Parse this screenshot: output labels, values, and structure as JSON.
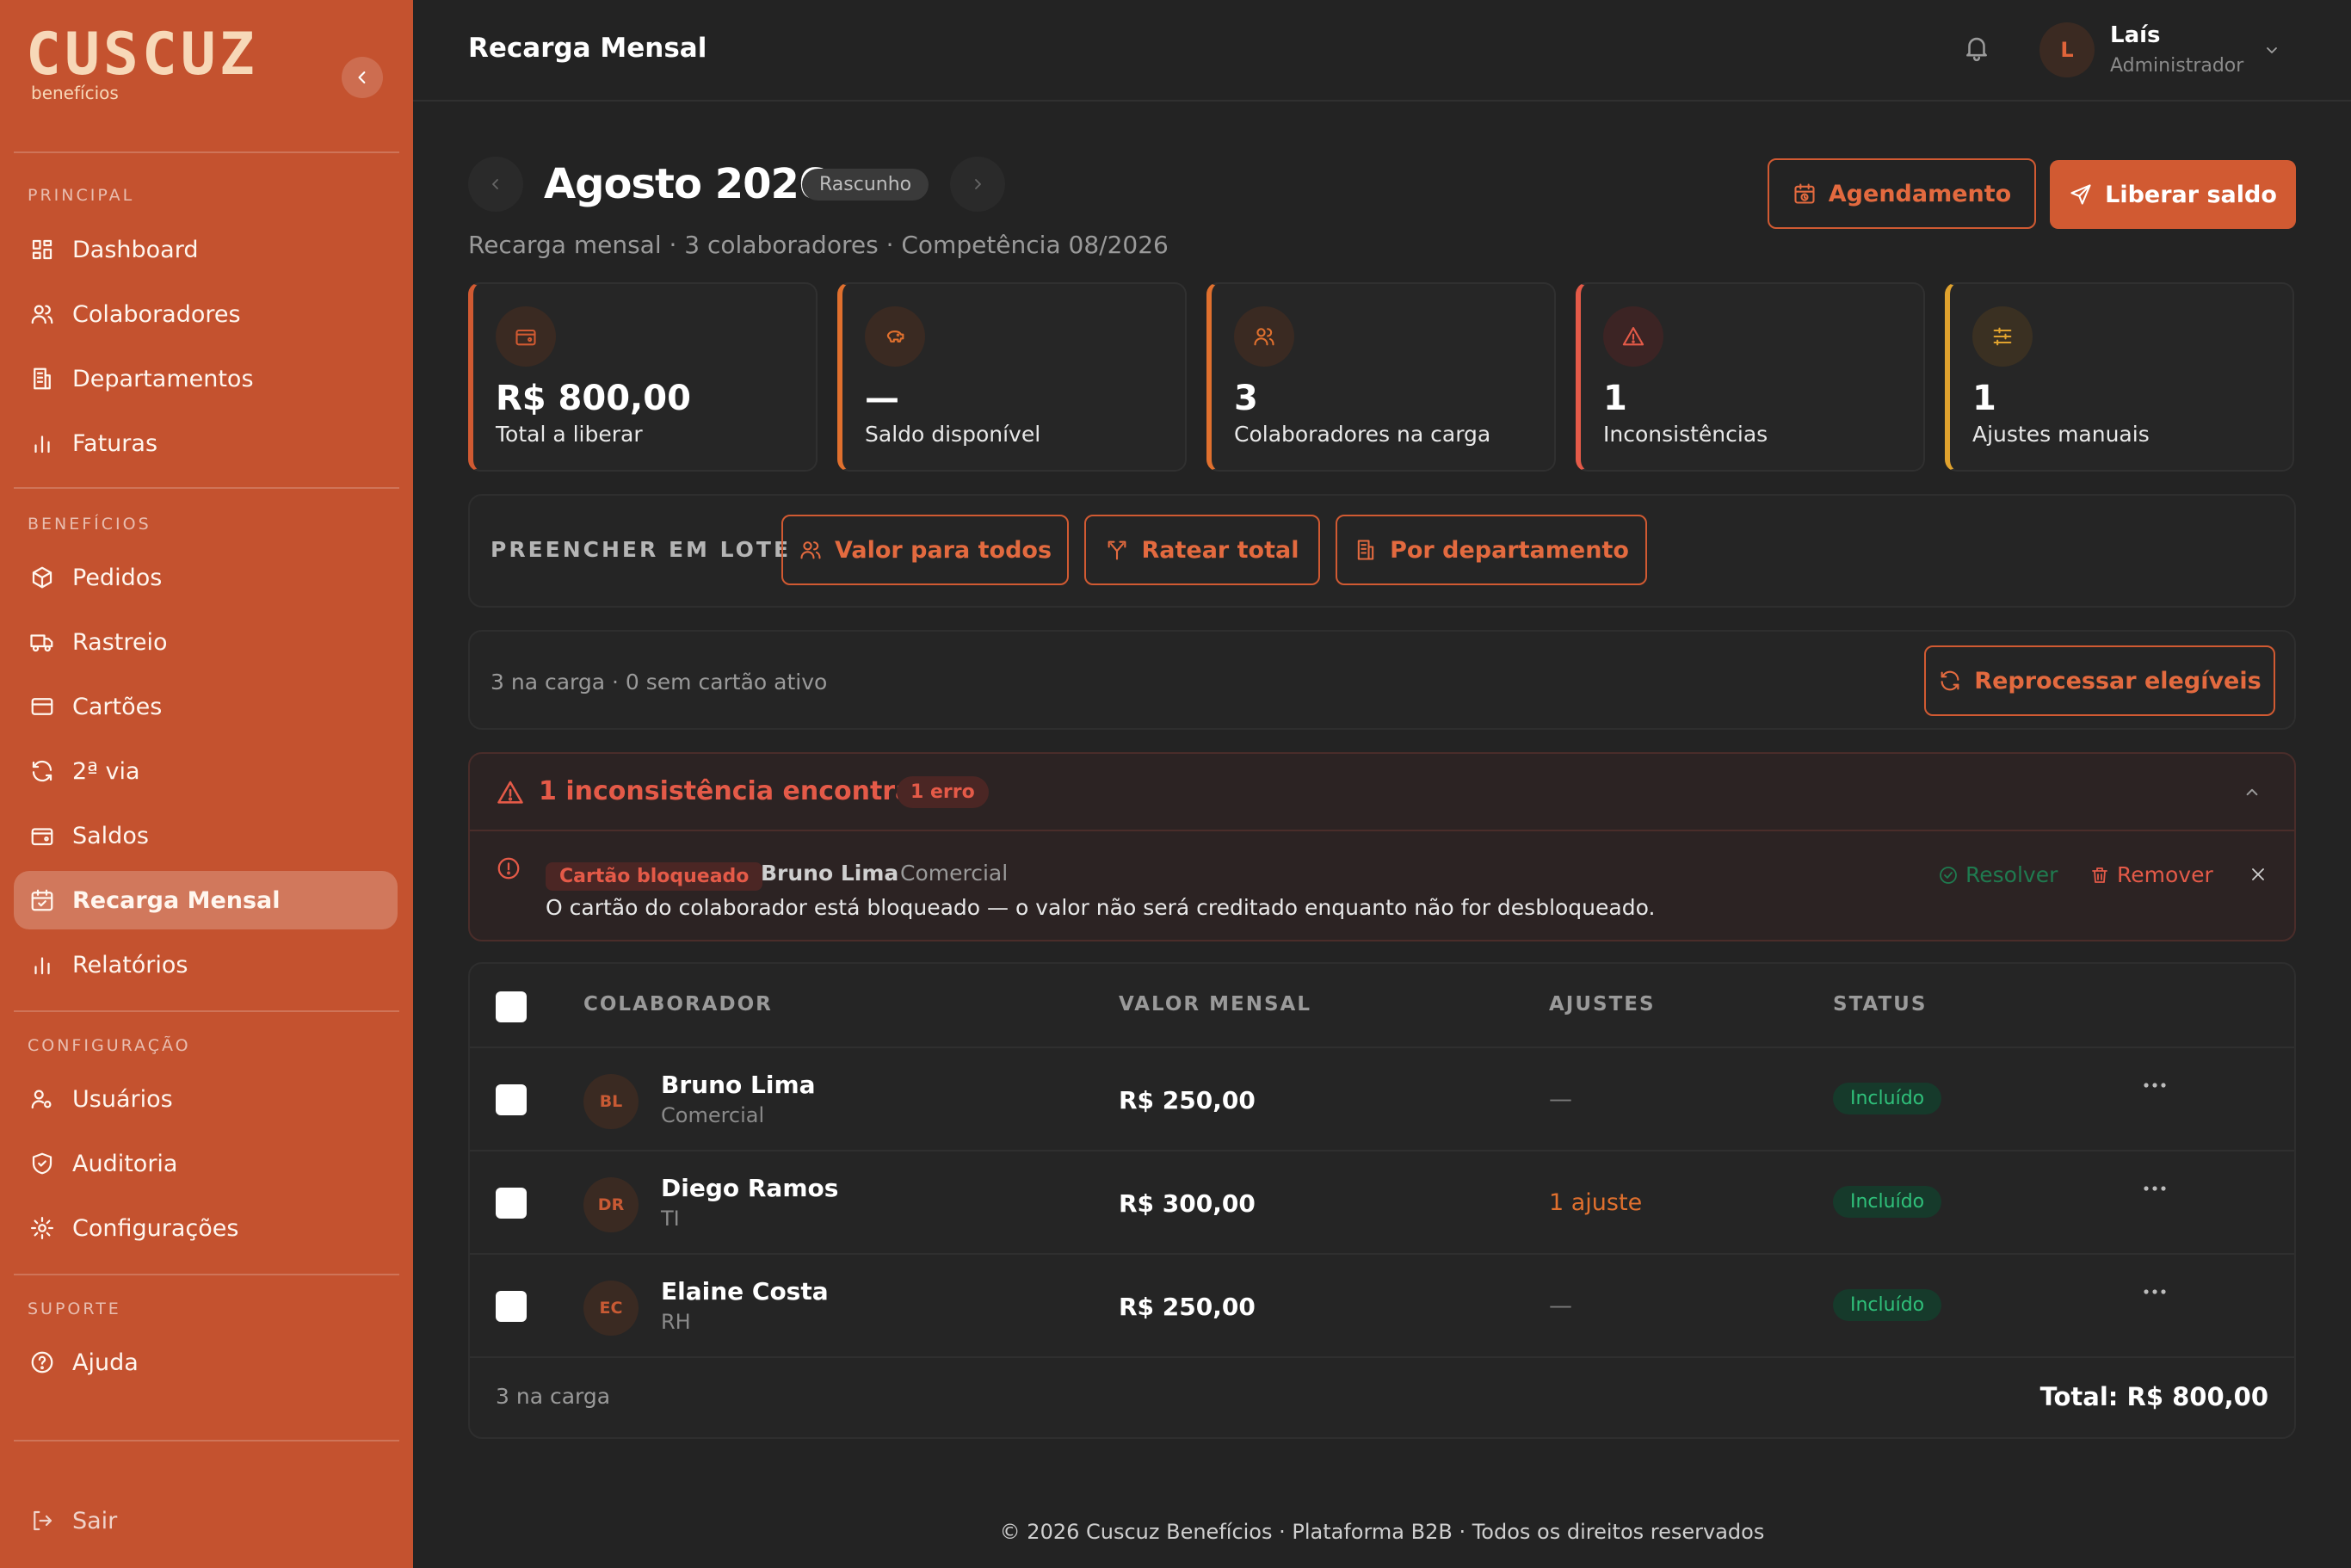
{
  "sidebar": {
    "logo_text": "CUSCUZ",
    "logo_sub": "benefícios",
    "sections": {
      "principal": "PRINCIPAL",
      "beneficios": "BENEFÍCIOS",
      "configuracao": "CONFIGURAÇÃO",
      "suporte": "SUPORTE"
    },
    "items": {
      "dashboard": "Dashboard",
      "colaboradores": "Colaboradores",
      "departamentos": "Departamentos",
      "faturas": "Faturas",
      "pedidos": "Pedidos",
      "rastreio": "Rastreio",
      "cartoes": "Cartões",
      "segunda_via": "2ª via",
      "saldos": "Saldos",
      "recarga": "Recarga Mensal",
      "relatorios": "Relatórios",
      "usuarios": "Usuários",
      "auditoria": "Auditoria",
      "configuracoes": "Configurações",
      "ajuda": "Ajuda"
    },
    "logout": "Sair",
    "active_item": "recarga"
  },
  "header": {
    "title": "Recarga Mensal",
    "user": {
      "initial": "L",
      "name": "Laís",
      "role": "Administrador"
    }
  },
  "period": {
    "month": "Agosto 2026",
    "status": "Rascunho",
    "subtitle": "Recarga mensal · 3 colaboradores · Competência 08/2026"
  },
  "actions": {
    "schedule": "Agendamento",
    "release": "Liberar saldo"
  },
  "stats": [
    {
      "value": "R$ 800,00",
      "label": "Total a liberar",
      "icon": "wallet-icon"
    },
    {
      "value": "—",
      "label": "Saldo disponível",
      "icon": "piggy-bank-icon"
    },
    {
      "value": "3",
      "label": "Colaboradores na carga",
      "icon": "users-icon"
    },
    {
      "value": "1",
      "label": "Inconsistências",
      "icon": "alert-triangle-icon"
    },
    {
      "value": "1",
      "label": "Ajustes manuais",
      "icon": "sliders-icon"
    }
  ],
  "batch": {
    "label": "PREENCHER EM LOTE",
    "buttons": {
      "all": "Valor para todos",
      "split": "Ratear total",
      "dept": "Por departamento"
    }
  },
  "eligibility": {
    "text": "3 na carga · 0 sem cartão ativo",
    "reprocess": "Reprocessar elegíveis"
  },
  "issues": {
    "title": "1 inconsistência encontrada",
    "badge": "1 erro",
    "item": {
      "tag": "Cartão bloqueado",
      "name": "Bruno Lima",
      "dept": "Comercial",
      "message": "O cartão do colaborador está bloqueado — o valor não será creditado enquanto não for desbloqueado.",
      "resolve": "Resolver",
      "remove": "Remover"
    }
  },
  "table": {
    "headers": {
      "colaborador": "COLABORADOR",
      "valor": "VALOR MENSAL",
      "ajustes": "AJUSTES",
      "status": "STATUS"
    },
    "rows": [
      {
        "initials": "BL",
        "name": "Bruno Lima",
        "dept": "Comercial",
        "value": "R$ 250,00",
        "adjust": "—",
        "status": "Incluído"
      },
      {
        "initials": "DR",
        "name": "Diego Ramos",
        "dept": "TI",
        "value": "R$ 300,00",
        "adjust": "1 ajuste",
        "status": "Incluído"
      },
      {
        "initials": "EC",
        "name": "Elaine Costa",
        "dept": "RH",
        "value": "R$ 250,00",
        "adjust": "—",
        "status": "Incluído"
      }
    ],
    "footer_count": "3 na carga",
    "footer_total": "Total: R$ 800,00"
  },
  "footer": "© 2026 Cuscuz Benefícios · Plataforma B2B · Todos os direitos reservados",
  "colors": {
    "brand": "#c4522f",
    "accent": "#d15a32",
    "success": "#2fc07a",
    "danger": "#e45a48",
    "warning": "#e0702e"
  }
}
